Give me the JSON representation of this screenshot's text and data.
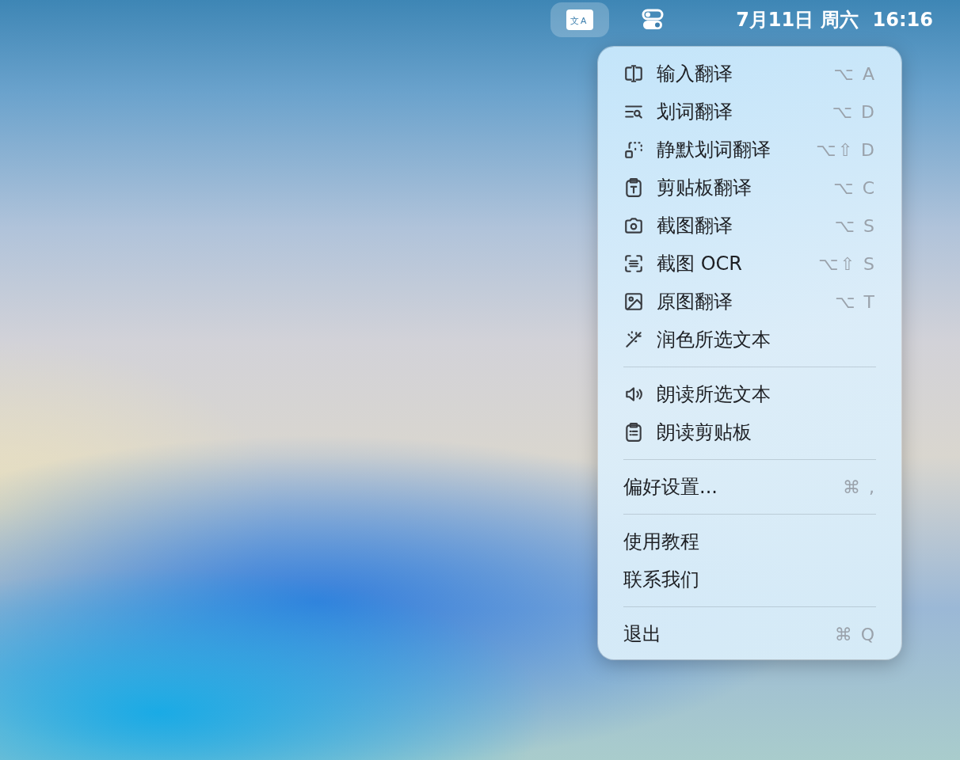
{
  "menubar": {
    "status_icons": [
      {
        "selected": true,
        "glyphs": [
          "文",
          "A"
        ]
      },
      {
        "selected": false
      }
    ],
    "date": "7月11日 周六",
    "time": "16:16"
  },
  "menu": {
    "sections": [
      {
        "kind": "with-icons",
        "items": [
          {
            "label": "输入翻译",
            "shortcut": "⌥ A"
          },
          {
            "label": "划词翻译",
            "shortcut": "⌥ D"
          },
          {
            "label": "静默划词翻译",
            "shortcut": "⌥⇧ D"
          },
          {
            "label": "剪贴板翻译",
            "shortcut": "⌥ C"
          },
          {
            "label": "截图翻译",
            "shortcut": "⌥ S"
          },
          {
            "label": "截图 OCR",
            "shortcut": "⌥⇧ S"
          },
          {
            "label": "原图翻译",
            "shortcut": "⌥ T"
          },
          {
            "label": "润色所选文本"
          }
        ]
      },
      {
        "kind": "with-icons",
        "items": [
          {
            "label": "朗读所选文本"
          },
          {
            "label": "朗读剪贴板"
          }
        ]
      },
      {
        "kind": "plain",
        "items": [
          {
            "label": "偏好设置...",
            "shortcut": "⌘ ,"
          }
        ]
      },
      {
        "kind": "plain",
        "items": [
          {
            "label": "使用教程"
          },
          {
            "label": "联系我们"
          }
        ]
      },
      {
        "kind": "plain",
        "items": [
          {
            "label": "退出",
            "shortcut": "⌘ Q"
          }
        ]
      }
    ]
  }
}
